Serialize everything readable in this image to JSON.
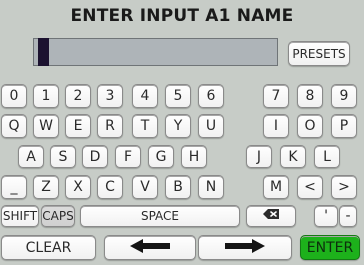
{
  "title": "ENTER INPUT A1 NAME",
  "input": {
    "value": ""
  },
  "buttons": {
    "presets": "PRESETS",
    "shift": "SHIFT",
    "caps": "CAPS",
    "space": "SPACE",
    "clear": "CLEAR",
    "enter": "ENTER"
  },
  "rows": {
    "numbers": [
      "0",
      "1",
      "2",
      "3",
      "4",
      "5",
      "6",
      "7",
      "8",
      "9"
    ],
    "qwerty": [
      "Q",
      "W",
      "E",
      "R",
      "T",
      "Y",
      "U",
      "I",
      "O",
      "P"
    ],
    "asdf": [
      "A",
      "S",
      "D",
      "F",
      "G",
      "H",
      "J",
      "K",
      "L"
    ],
    "zxcv": [
      "_",
      "Z",
      "X",
      "C",
      "V",
      "B",
      "N",
      "M",
      "<",
      ">"
    ],
    "misc": [
      "'",
      "-"
    ]
  },
  "icons": {
    "backspace": "backspace-icon",
    "left": "arrow-left-icon",
    "right": "arrow-right-icon"
  },
  "colors": {
    "enter": "#1db11b",
    "panel": "#c7ccc7",
    "textfield": "#aeb4b8"
  }
}
